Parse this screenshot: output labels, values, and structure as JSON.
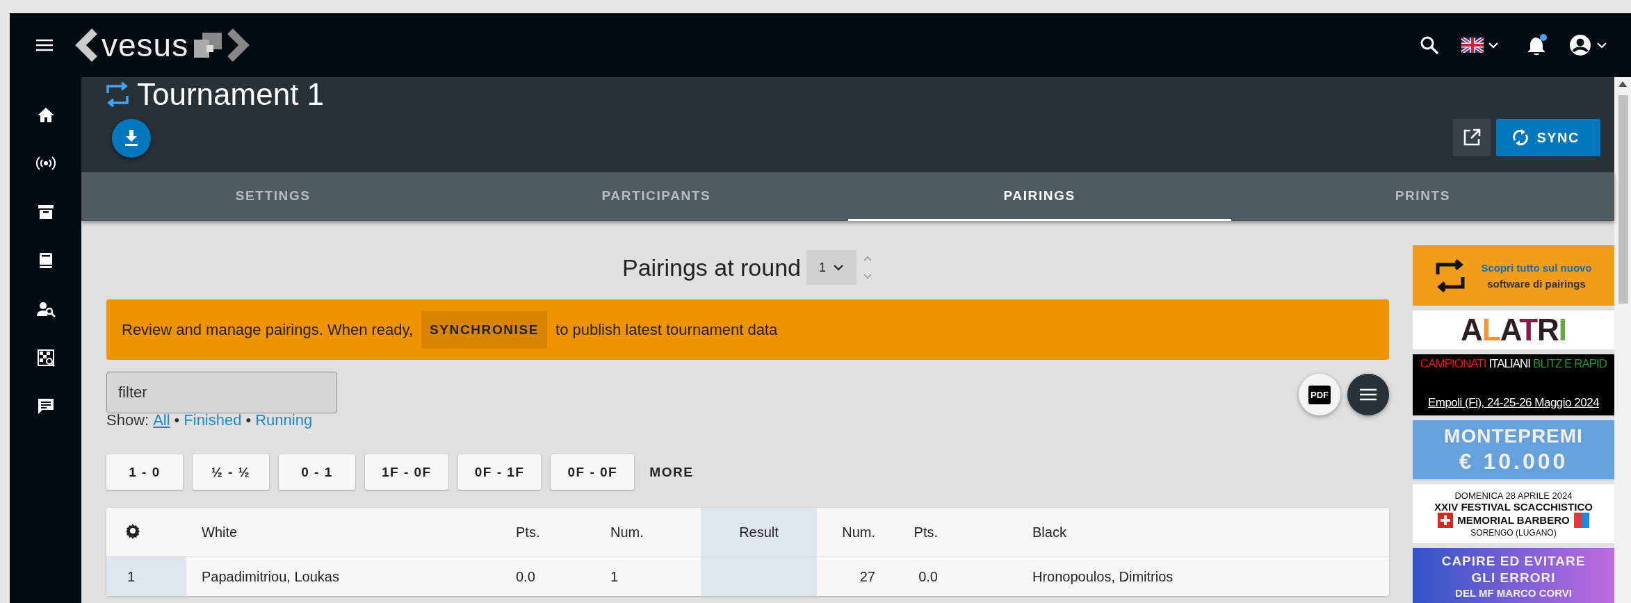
{
  "app_bar": {
    "logo": "vesus"
  },
  "header": {
    "title": "Tournament 1",
    "sync_button": "SYNC"
  },
  "tabs": [
    {
      "label": "SETTINGS",
      "selected": false
    },
    {
      "label": "PARTICIPANTS",
      "selected": false
    },
    {
      "label": "PAIRINGS",
      "selected": true
    },
    {
      "label": "PRINTS",
      "selected": false
    }
  ],
  "round_selector": {
    "label": "Pairings at round",
    "value": "1"
  },
  "notice": {
    "text_before": "Review and manage pairings. When ready,",
    "button": "SYNCHRONISE",
    "text_after": "to publish latest tournament data"
  },
  "filter": {
    "placeholder": "filter"
  },
  "show_filter": {
    "label": "Show:",
    "separators": [
      "•",
      "•"
    ],
    "links": [
      {
        "label": "All",
        "selected": true
      },
      {
        "label": "Finished",
        "selected": false
      },
      {
        "label": "Running",
        "selected": false
      }
    ]
  },
  "pdf_button": "PDF",
  "result_buttons": [
    "1 - 0",
    "½ - ½",
    "0 - 1",
    "1F - 0F",
    "0F - 1F",
    "0F - 0F"
  ],
  "more_button": "MORE",
  "table": {
    "columns": [
      "White",
      "Pts.",
      "Num.",
      "Result",
      "Num.",
      "Pts.",
      "Black"
    ],
    "rows": [
      {
        "board": "1",
        "white": "Papadimitriou, Loukas",
        "white_pts": "0.0",
        "white_num": "1",
        "black_num": "27",
        "black_pts": "0.0",
        "black": "Hronopoulos, Dimitrios"
      }
    ]
  },
  "ads": [
    {
      "kind": "software",
      "lines": [
        "Scopri tutto sul nuovo",
        "software di pairings"
      ]
    },
    {
      "kind": "logo",
      "lines": [
        "ALATRI"
      ]
    },
    {
      "kind": "championship",
      "lines": [
        "CAMPIONATI",
        "ITALIANI",
        "BLITZ E RAPID",
        "Empoli (Fi), 24-25-26 Maggio 2024"
      ]
    },
    {
      "kind": "prize",
      "lines": [
        "MONTEPREMI",
        "€ 10.000"
      ]
    },
    {
      "kind": "festival",
      "lines": [
        "DOMENICA 28 APRILE 2024",
        "XXIV FESTIVAL SCACCHISTICO",
        "MEMORIAL BARBERO",
        "SORENGO (LUGANO)"
      ]
    },
    {
      "kind": "course",
      "lines": [
        "CAPIRE ED EVITARE",
        "GLI ERRORI",
        "DEL MF MARCO CORVI"
      ]
    }
  ]
}
